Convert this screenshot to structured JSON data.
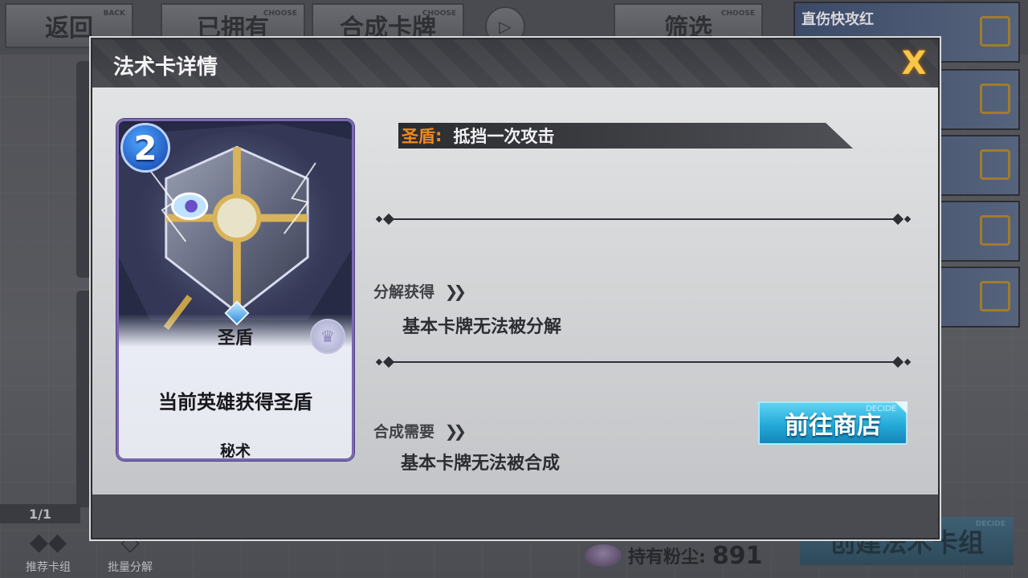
{
  "background": {
    "back_label": "返回",
    "back_sub": "BACK",
    "owned_label": "已拥有",
    "owned_sub": "CHOOSE",
    "craft_label": "合成卡牌",
    "craft_sub": "CHOOSE",
    "filter_label": "筛选",
    "filter_sub": "CHOOSE",
    "deck_name": "直伤快攻红",
    "page_indicator": "1/1",
    "recommend_label": "推荐卡组",
    "batch_label": "批量分解",
    "dust_label": "持有粉尘:",
    "dust_value": "891",
    "create_label": "创建法术卡组",
    "create_sub": "DECIDE"
  },
  "modal": {
    "title": "法术卡详情",
    "close_glyph": "X",
    "card": {
      "cost": "2",
      "name": "圣盾",
      "description": "当前英雄获得圣盾",
      "type": "秘术"
    },
    "effect": {
      "keyword": "圣盾",
      "colon": ":",
      "text": "抵挡一次攻击"
    },
    "disenchant": {
      "title": "分解获得",
      "value": "基本卡牌无法被分解"
    },
    "craft": {
      "title": "合成需要",
      "value": "基本卡牌无法被合成"
    },
    "shop_button": {
      "label": "前往商店",
      "sub": "DECIDE"
    }
  },
  "colors": {
    "accent_orange": "#f08a1c",
    "shop_blue": "#24a9d8",
    "close_gold": "#f6c84a",
    "card_frame": "#7a68b0"
  },
  "icons": {
    "close": "close-icon",
    "chevrons": "double-chevron-right-icon",
    "rarity": "crown-icon",
    "edit": "edit-icon"
  }
}
